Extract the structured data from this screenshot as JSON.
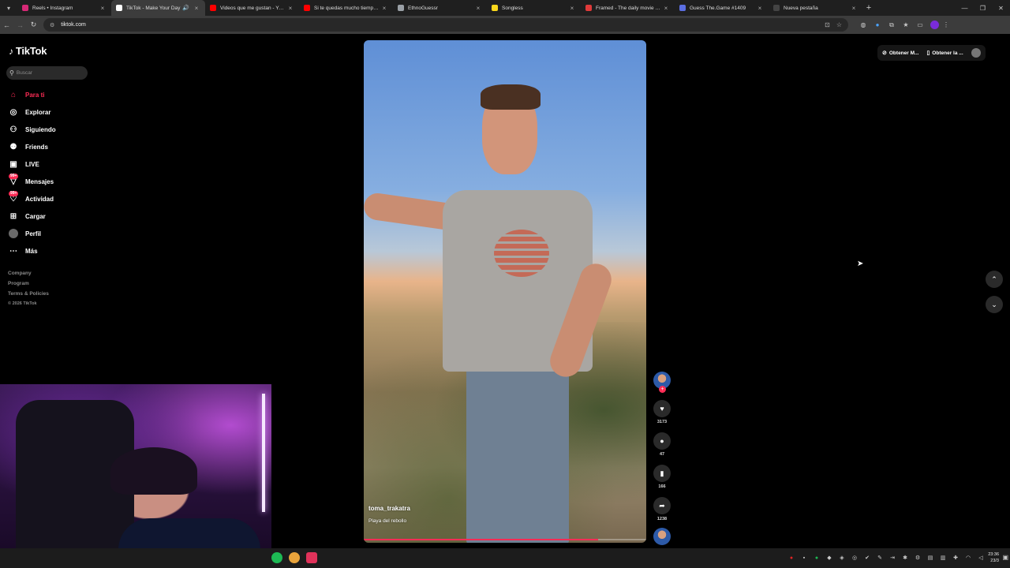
{
  "browser": {
    "tabs": [
      {
        "title": "Reels • Instagram",
        "favicon_color": "#d62976",
        "active": false
      },
      {
        "title": "TikTok - Make Your Day",
        "favicon_color": "#ffffff",
        "active": true
      },
      {
        "title": "Videos que me gustan - YouTube",
        "favicon_color": "#ff0000",
        "active": false
      },
      {
        "title": "Si te quedas mucho tiempo en",
        "favicon_color": "#ff0000",
        "active": false
      },
      {
        "title": "EthnoGuessr",
        "favicon_color": "#9aa0a6",
        "active": false
      },
      {
        "title": "Songless",
        "favicon_color": "#f9d71c",
        "active": false
      },
      {
        "title": "Framed - The daily movie guess",
        "favicon_color": "#e03a3a",
        "active": false
      },
      {
        "title": "Guess The.Game #1409",
        "favicon_color": "#5b6ee1",
        "active": false
      },
      {
        "title": "Nueva pestaña",
        "favicon_color": "#444444",
        "active": false
      }
    ],
    "url": "tiktok.com"
  },
  "tiktok": {
    "logo_text": "TikTok",
    "search_placeholder": "Buscar",
    "nav": [
      {
        "label": "Para ti",
        "icon": "home-icon",
        "active": true
      },
      {
        "label": "Explorar",
        "icon": "compass-icon"
      },
      {
        "label": "Siguiendo",
        "icon": "following-icon"
      },
      {
        "label": "Friends",
        "icon": "friends-icon"
      },
      {
        "label": "LIVE",
        "icon": "live-icon"
      },
      {
        "label": "Mensajes",
        "icon": "message-icon",
        "badge": "99+"
      },
      {
        "label": "Actividad",
        "icon": "activity-icon",
        "badge": "99+"
      },
      {
        "label": "Cargar",
        "icon": "upload-icon"
      },
      {
        "label": "Perfil",
        "icon": "avatar"
      },
      {
        "label": "Más",
        "icon": "more-icon"
      }
    ],
    "footer": {
      "company": "Company",
      "program": "Program",
      "terms": "Terms & Policies",
      "copyright": "© 2026 TikTok"
    },
    "top_buttons": {
      "get_app": "Obtener M...",
      "get_desktop": "Obtener la ..."
    },
    "video": {
      "username": "toma_trakatra",
      "description": "Playa del rebollo",
      "progress": 0.83
    },
    "actions": {
      "likes": "3173",
      "comments": "47",
      "saves": "166",
      "shares": "1238"
    }
  },
  "taskbar": {
    "time": "23:36",
    "date": "23/3"
  },
  "colors": {
    "accent": "#fe2c55",
    "background": "#000000"
  }
}
